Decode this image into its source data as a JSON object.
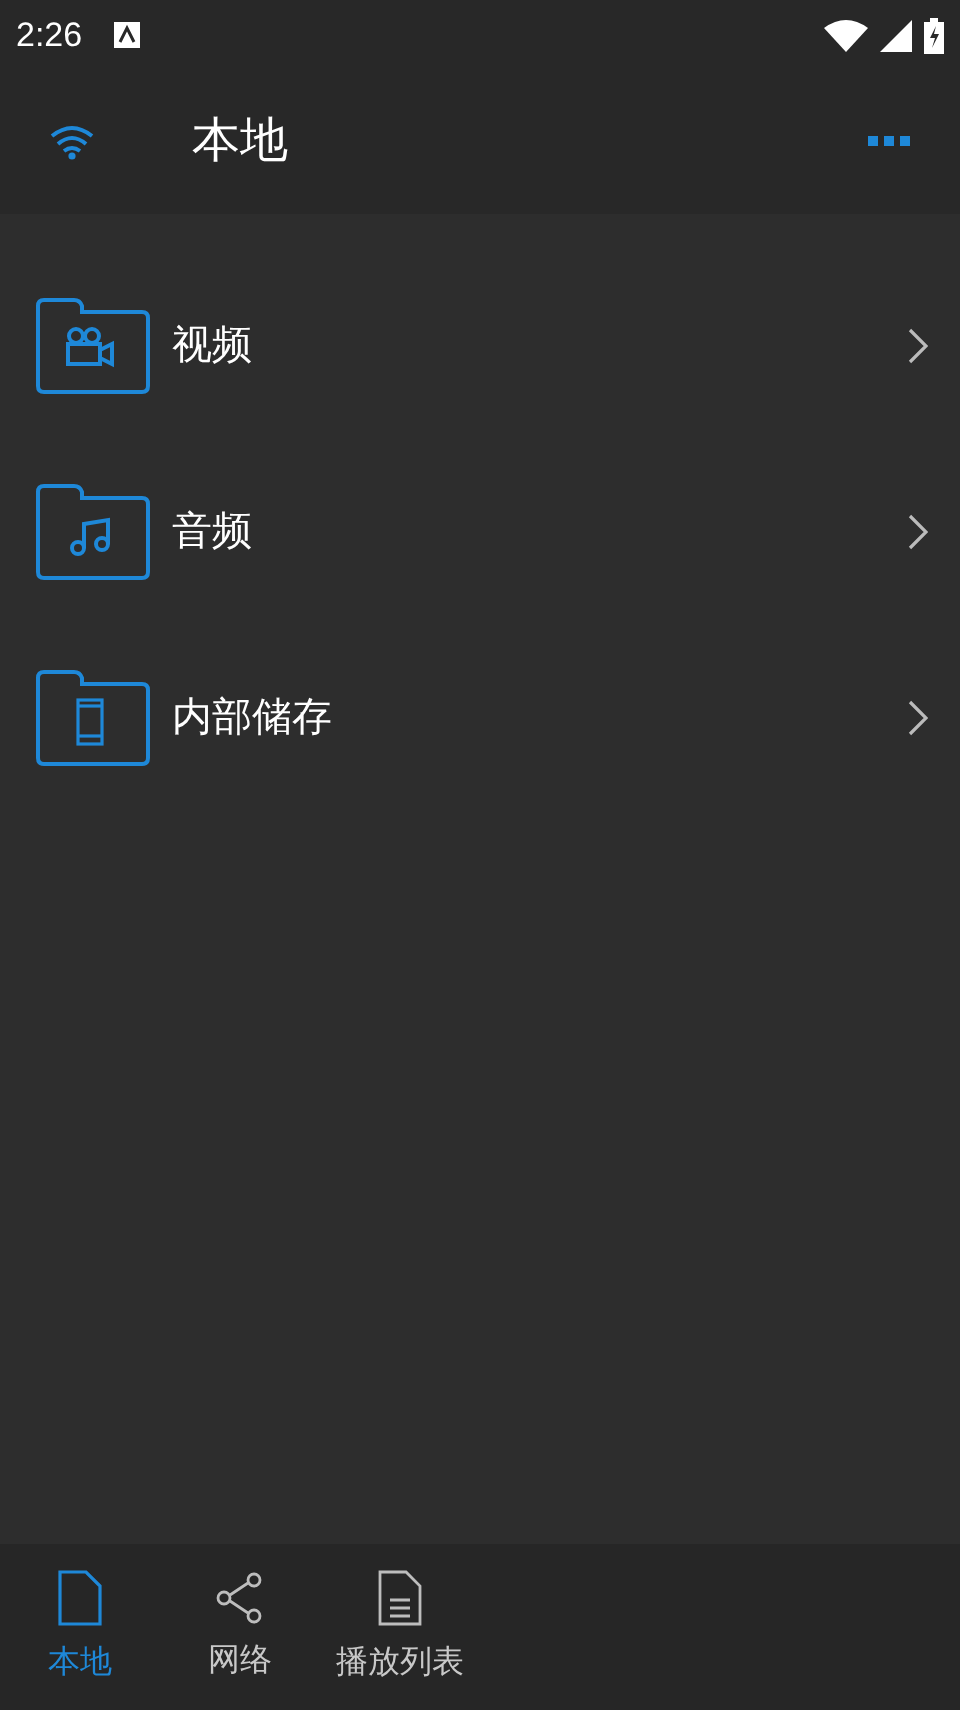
{
  "status_bar": {
    "time": "2:26"
  },
  "header": {
    "title": "本地"
  },
  "items": [
    {
      "label": "视频",
      "kind": "video"
    },
    {
      "label": "音频",
      "kind": "audio"
    },
    {
      "label": "内部储存",
      "kind": "storage"
    }
  ],
  "tabs": [
    {
      "label": "本地",
      "kind": "file",
      "selected": true
    },
    {
      "label": "网络",
      "kind": "share",
      "selected": false
    },
    {
      "label": "播放列表",
      "kind": "list",
      "selected": false
    }
  ]
}
